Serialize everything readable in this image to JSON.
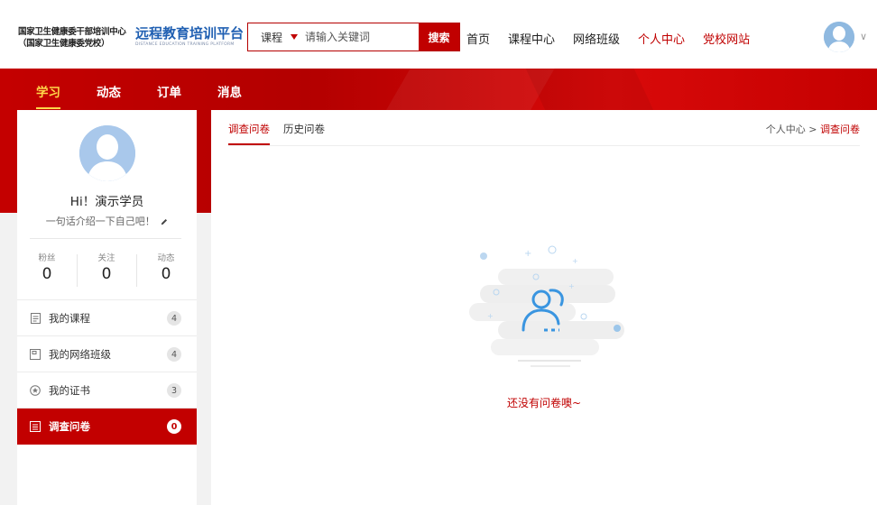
{
  "header": {
    "org_line1": "国家卫生健康委干部培训中心",
    "org_line2": "（国家卫生健康委党校）",
    "platform_name": "远程教育培训平台",
    "platform_en": "DISTANCE EDUCATION TRAINING PLATFORM",
    "search": {
      "scope": "课程",
      "placeholder": "请输入关键词",
      "button": "搜索"
    },
    "nav": [
      "首页",
      "课程中心",
      "网络班级",
      "个人中心",
      "党校网站"
    ],
    "colors": {
      "brand_red": "#c00000",
      "platform_blue": "#1f5fb2",
      "subnav_active": "#ffd84a"
    }
  },
  "subnav": [
    "学习",
    "动态",
    "订单",
    "消息"
  ],
  "profile": {
    "greeting": "Hi！演示学员",
    "intro": "一句话介绍一下自己吧！",
    "stats": [
      {
        "label": "粉丝",
        "value": "0"
      },
      {
        "label": "关注",
        "value": "0"
      },
      {
        "label": "动态",
        "value": "0"
      }
    ]
  },
  "menu": [
    {
      "label": "我的课程",
      "count": "4",
      "icon": "document-icon"
    },
    {
      "label": "我的网络班级",
      "count": "4",
      "icon": "class-icon"
    },
    {
      "label": "我的证书",
      "count": "3",
      "icon": "star-badge-icon"
    },
    {
      "label": "调查问卷",
      "count": "0",
      "icon": "survey-icon"
    }
  ],
  "content": {
    "tabs": [
      "调查问卷",
      "历史问卷"
    ],
    "breadcrumb": {
      "parent": "个人中心",
      "separator": " > ",
      "current": "调查问卷"
    },
    "empty_text": "还没有问卷噢~"
  }
}
